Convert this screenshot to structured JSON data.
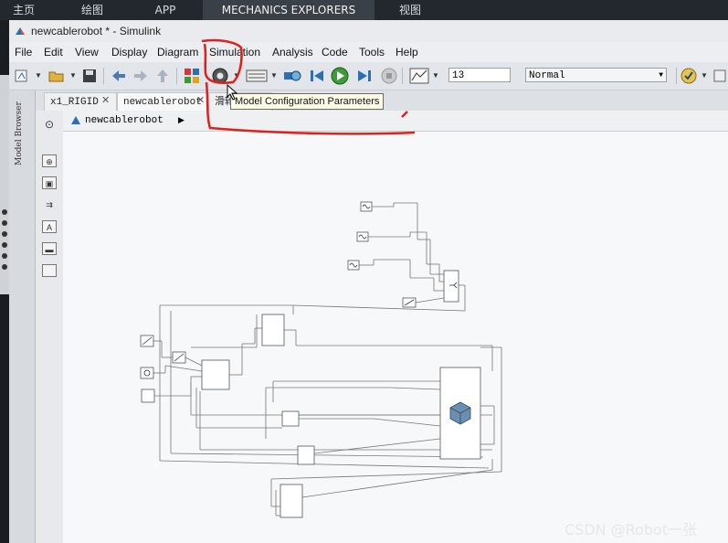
{
  "top_tabs": [
    "主页",
    "绘图",
    "APP",
    "MECHANICS EXPLORERS",
    "视图"
  ],
  "window": {
    "title": "newcablerobot * - Simulink"
  },
  "menu": [
    "File",
    "Edit",
    "View",
    "Display",
    "Diagram",
    "Simulation",
    "Analysis",
    "Code",
    "Tools",
    "Help"
  ],
  "toolbar": {
    "stop_time": "13",
    "sim_mode": "Normal",
    "tooltip": "Model Configuration Parameters"
  },
  "model_browser_label": "Model Browser",
  "doc_tabs": [
    "x1_RIGID",
    "newcablerobot",
    "滑轮"
  ],
  "breadcrumb": "newcablerobot",
  "watermark": "CSDN @Robot一张",
  "colors": {
    "annotation_red": "#e0201a",
    "taskbar": "#23272e"
  }
}
